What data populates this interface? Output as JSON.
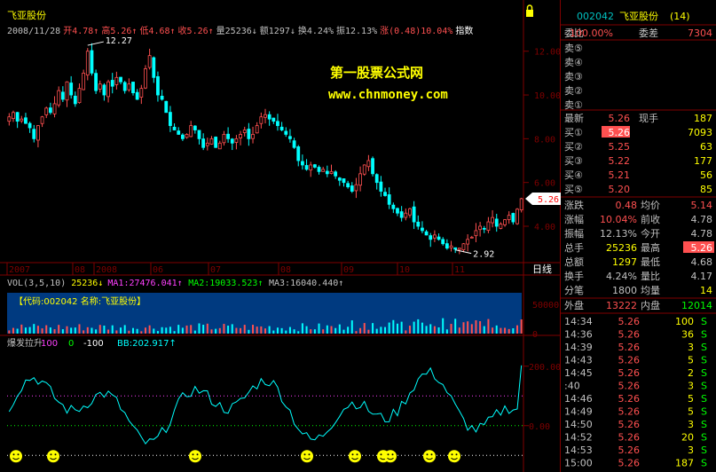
{
  "header": {
    "stock_name": "飞亚股份",
    "info_items": [
      {
        "label": "2008/11/28",
        "color": "#c0c0c0"
      },
      {
        "label": "开4.78↑",
        "color": "#ff5050"
      },
      {
        "label": "高5.26↑",
        "color": "#ff5050"
      },
      {
        "label": "低4.68↑",
        "color": "#ff5050"
      },
      {
        "label": "收5.26↑",
        "color": "#ff5050"
      },
      {
        "label": "量25236↓",
        "color": "#c0c0c0"
      },
      {
        "label": "额1297↓",
        "color": "#c0c0c0"
      },
      {
        "label": "换4.24%",
        "color": "#c0c0c0"
      },
      {
        "label": "振12.13%",
        "color": "#c0c0c0"
      },
      {
        "label": "涨(0.48)10.04%",
        "color": "#ff5050"
      },
      {
        "label": "指数",
        "color": "#ffffff"
      }
    ],
    "index_button": "指数"
  },
  "watermark": {
    "line1": "第一股票公式网",
    "line2": "www.chnmoney.com"
  },
  "main_chart": {
    "y_ticks": [
      "12.00",
      "10.00",
      "8.00",
      "6.00",
      "4.00"
    ],
    "current_price": "5.26",
    "max_label": "12.27",
    "min_label": "2.92",
    "x_labels": [
      "2007",
      "08",
      "2008",
      "06",
      "07",
      "08",
      "09",
      "10",
      "11"
    ],
    "period_label": "日线"
  },
  "volume": {
    "legend": [
      {
        "label": "VOL(3,5,10)",
        "color": "#c0c0c0"
      },
      {
        "label": "25236↓",
        "color": "#ffff00"
      },
      {
        "label": "MA1:27476.041↑",
        "color": "#ff40ff"
      },
      {
        "label": "MA2:19033.523↑",
        "color": "#00ff00"
      },
      {
        "label": "MA3:16040.440↑",
        "color": "#c0c0c0"
      }
    ],
    "overlay_text": "【代码:002042  名称:飞亚股份】",
    "y_ticks": [
      "50000",
      "0"
    ]
  },
  "indicator": {
    "legend": [
      {
        "label": "爆发拉升",
        "color": "#c0c0c0"
      },
      {
        "label": "100",
        "color": "#ff40ff"
      },
      {
        "label": "0",
        "color": "#00ff00"
      },
      {
        "label": "-100",
        "color": "#ffffff"
      },
      {
        "label": "BB:202.917↑",
        "color": "#00ffff"
      }
    ],
    "y_ticks": [
      "200.00",
      "0.00"
    ]
  },
  "quote_panel": {
    "code": "002042",
    "name": "飞亚股份",
    "count": "(14)",
    "weibi_label": "委比",
    "weibi_value": "100.00%",
    "weicha_label": "委差",
    "weicha_value": "7304",
    "sell_levels": [
      "卖⑤",
      "卖④",
      "卖③",
      "卖②",
      "卖①"
    ],
    "latest_label": "最新",
    "latest_value": "5.26",
    "xianshou_label": "现手",
    "xianshou_value": "187",
    "buy_levels": [
      {
        "label": "买①",
        "price": "5.26",
        "vol": "7093"
      },
      {
        "label": "买②",
        "price": "5.25",
        "vol": "63"
      },
      {
        "label": "买③",
        "price": "5.22",
        "vol": "177"
      },
      {
        "label": "买④",
        "price": "5.21",
        "vol": "56"
      },
      {
        "label": "买⑤",
        "price": "5.20",
        "vol": "85"
      }
    ],
    "stats": [
      {
        "l1": "涨跌",
        "v1": "0.48",
        "c1": "#ff5050",
        "l2": "均价",
        "v2": "5.14",
        "c2": "#ff5050"
      },
      {
        "l1": "涨幅",
        "v1": "10.04%",
        "c1": "#ff5050",
        "l2": "前收",
        "v2": "4.78",
        "c2": "#c0c0c0"
      },
      {
        "l1": "振幅",
        "v1": "12.13%",
        "c1": "#c0c0c0",
        "l2": "今开",
        "v2": "4.78",
        "c2": "#c0c0c0"
      },
      {
        "l1": "总手",
        "v1": "25236",
        "c1": "#ffff00",
        "l2": "最高",
        "v2": "5.26",
        "c2": "#ff5050"
      },
      {
        "l1": "总额",
        "v1": "1297",
        "c1": "#ffff00",
        "l2": "最低",
        "v2": "4.68",
        "c2": "#c0c0c0"
      },
      {
        "l1": "换手",
        "v1": "4.24%",
        "c1": "#c0c0c0",
        "l2": "量比",
        "v2": "4.17",
        "c2": "#c0c0c0"
      },
      {
        "l1": "分笔",
        "v1": "1800",
        "c1": "#c0c0c0",
        "l2": "均量",
        "v2": "14",
        "c2": "#ffff00"
      }
    ],
    "waipan_label": "外盘",
    "waipan_value": "13222",
    "neipan_label": "内盘",
    "neipan_value": "12014",
    "ticks": [
      {
        "time": "14:34",
        "price": "5.26",
        "vol": "100",
        "side": "S"
      },
      {
        "time": "14:36",
        "price": "5.26",
        "vol": "36",
        "side": "S"
      },
      {
        "time": "14:39",
        "price": "5.26",
        "vol": "3",
        "side": "S"
      },
      {
        "time": "14:43",
        "price": "5.26",
        "vol": "5",
        "side": "S"
      },
      {
        "time": "14:45",
        "price": "5.26",
        "vol": "2",
        "side": "S"
      },
      {
        "time": ":40",
        "price": "5.26",
        "vol": "3",
        "side": "S"
      },
      {
        "time": "14:46",
        "price": "5.26",
        "vol": "5",
        "side": "S"
      },
      {
        "time": "14:49",
        "price": "5.26",
        "vol": "5",
        "side": "S"
      },
      {
        "time": "14:50",
        "price": "5.26",
        "vol": "3",
        "side": "S"
      },
      {
        "time": "14:52",
        "price": "5.26",
        "vol": "20",
        "side": "S"
      },
      {
        "time": "14:53",
        "price": "5.26",
        "vol": "3",
        "side": "S"
      },
      {
        "time": "15:00",
        "price": "5.26",
        "vol": "187",
        "side": "S"
      }
    ]
  },
  "chart_data": {
    "type": "candlestick",
    "date_range": [
      "2007",
      "2008/11/28"
    ],
    "price_ylim": [
      2.5,
      12.8
    ],
    "close_series": [
      9.0,
      9.2,
      8.8,
      8.9,
      8.7,
      8.5,
      8.0,
      8.6,
      9.0,
      9.4,
      9.2,
      9.6,
      10.2,
      9.8,
      10.6,
      10.0,
      9.6,
      10.3,
      11.0,
      12.0,
      11.0,
      10.2,
      10.5,
      10.0,
      10.6,
      10.4,
      10.8,
      10.6,
      10.2,
      10.5,
      10.1,
      9.8,
      10.3,
      11.2,
      11.8,
      10.8,
      10.0,
      9.8,
      9.2,
      8.6,
      8.4,
      8.2,
      8.0,
      8.2,
      8.6,
      8.4,
      8.0,
      7.6,
      7.8,
      8.0,
      7.6,
      7.8,
      8.2,
      8.0,
      7.8,
      8.0,
      8.2,
      8.4,
      8.0,
      8.2,
      8.6,
      9.0,
      9.1,
      8.9,
      8.8,
      8.6,
      8.4,
      8.2,
      8.0,
      7.6,
      7.0,
      6.8,
      6.6,
      6.8,
      6.7,
      6.5,
      6.6,
      6.4,
      6.5,
      6.3,
      6.1,
      6.0,
      5.8,
      5.6,
      5.9,
      6.4,
      6.8,
      7.0,
      6.4,
      6.0,
      5.6,
      5.4,
      5.0,
      4.8,
      4.6,
      4.4,
      4.6,
      4.8,
      4.2,
      4.0,
      3.8,
      3.6,
      3.4,
      3.6,
      3.4,
      3.2,
      3.0,
      3.1,
      2.95,
      3.0,
      3.2,
      3.4,
      3.5,
      3.8,
      4.0,
      3.9,
      4.2,
      4.4,
      4.0,
      4.1,
      4.3,
      4.5,
      4.2,
      4.78,
      5.26
    ],
    "max_price": 12.27,
    "min_price": 2.92,
    "last_close": 5.26,
    "volume": {
      "last": 25236,
      "ma1": 27476.041,
      "ma2": 19033.523,
      "ma3": 16040.44,
      "ylim": [
        0,
        70000
      ]
    },
    "indicator_bb": {
      "last": 202.917,
      "reference_lines": [
        100,
        0,
        -100
      ],
      "ylim": [
        -150,
        250
      ]
    }
  }
}
